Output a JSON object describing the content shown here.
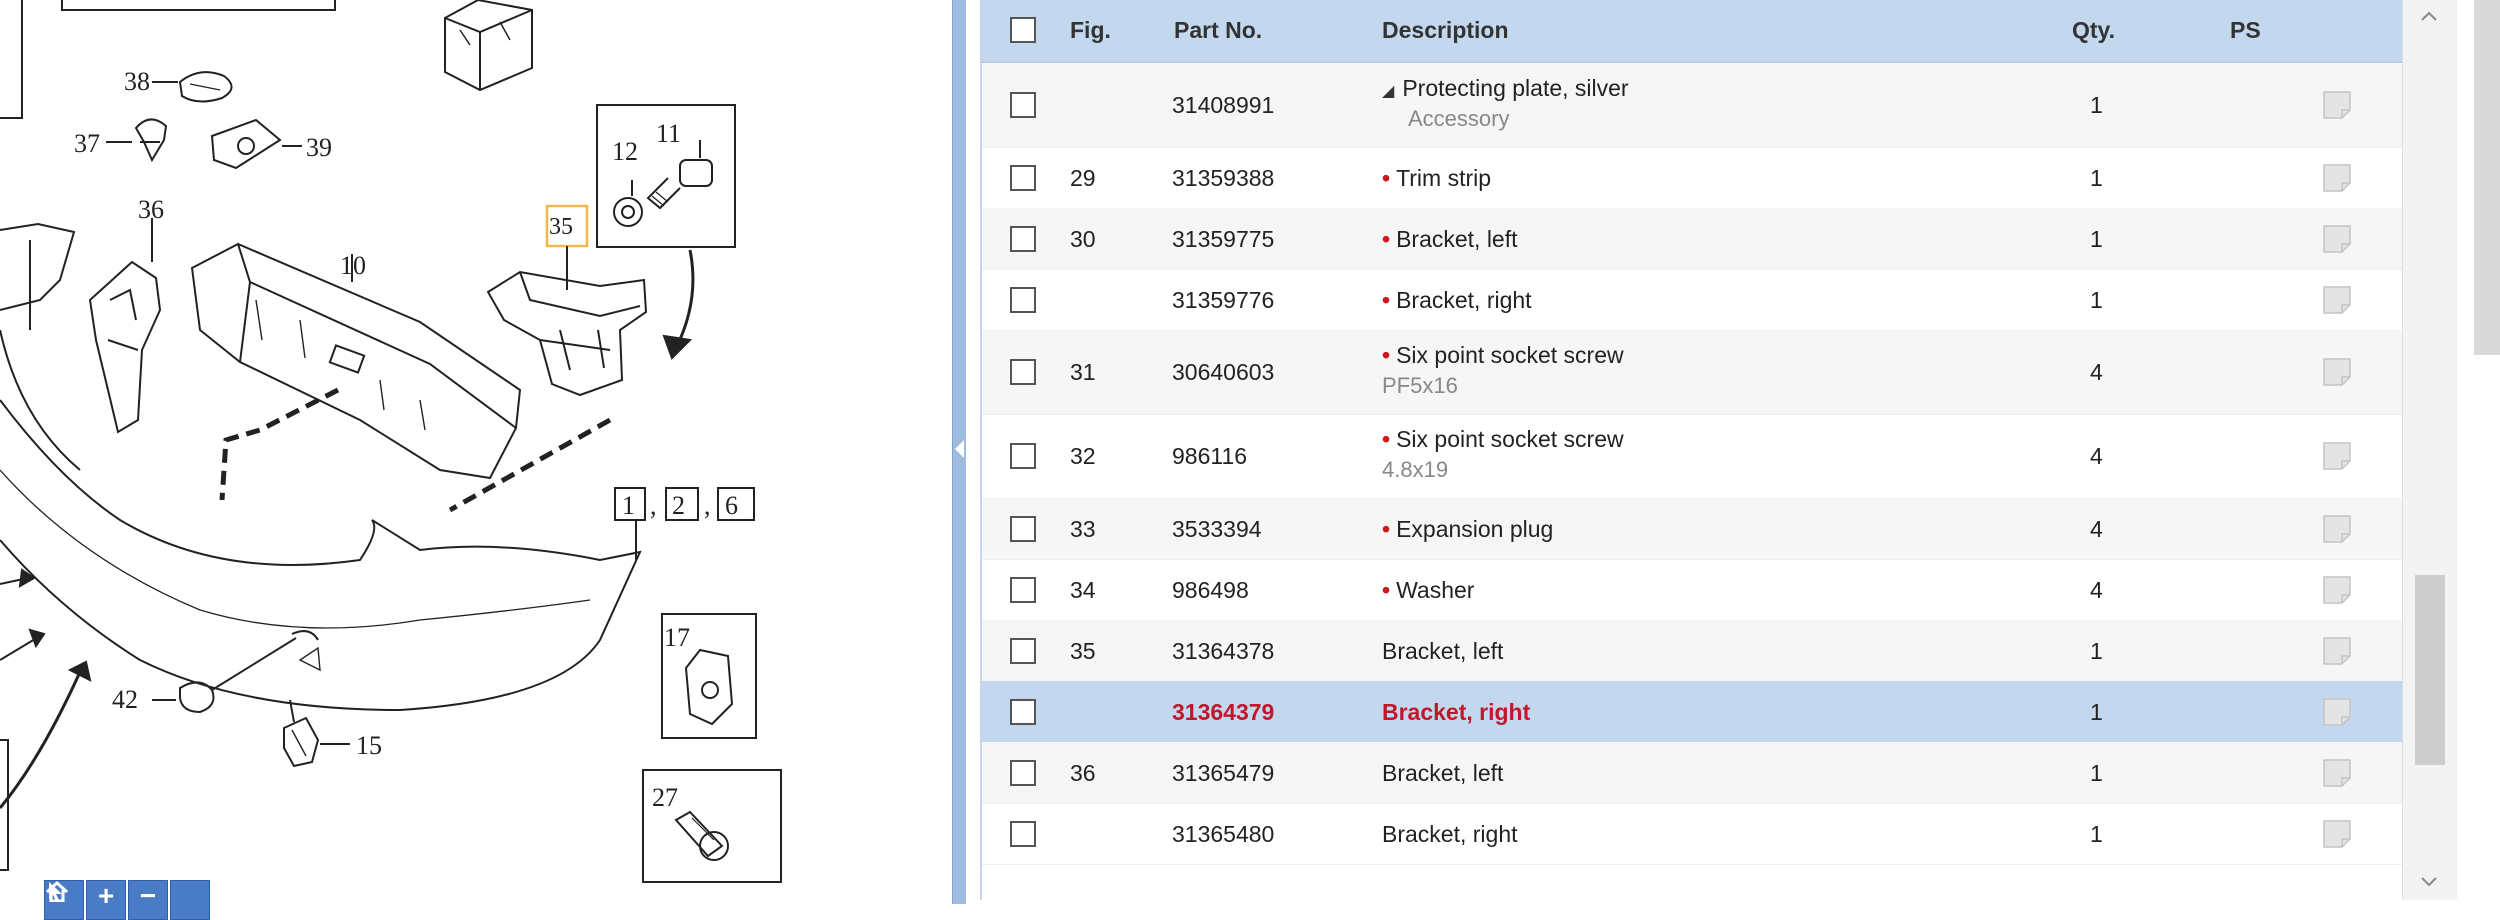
{
  "diagram": {
    "callouts": [
      {
        "id": "c38",
        "label": "38"
      },
      {
        "id": "c37",
        "label": "37"
      },
      {
        "id": "c39",
        "label": "39"
      },
      {
        "id": "c12",
        "label": "12"
      },
      {
        "id": "c11",
        "label": "11"
      },
      {
        "id": "c36",
        "label": "36"
      },
      {
        "id": "c10",
        "label": "10"
      },
      {
        "id": "c35",
        "label": "35"
      },
      {
        "id": "c1",
        "label": "1"
      },
      {
        "id": "c2",
        "label": "2"
      },
      {
        "id": "c6",
        "label": "6"
      },
      {
        "id": "c17",
        "label": "17"
      },
      {
        "id": "c42",
        "label": "42"
      },
      {
        "id": "c15",
        "label": "15"
      },
      {
        "id": "c27",
        "label": "27"
      }
    ],
    "highlight_color": "#f0b84a",
    "toolbar": [
      {
        "icon": "cursor-icon",
        "glyph": ""
      },
      {
        "icon": "zoom-in-icon",
        "glyph": "+"
      },
      {
        "icon": "zoom-out-icon",
        "glyph": "−"
      },
      {
        "icon": "home-icon",
        "glyph": ""
      }
    ]
  },
  "table": {
    "headers": {
      "fig": "Fig.",
      "part": "Part No.",
      "desc": "Description",
      "qty": "Qty.",
      "ps": "PS"
    },
    "accent_color": "#c0182b",
    "header_color": "#c3d8ee",
    "rows": [
      {
        "fig": "",
        "part": "31408991",
        "desc": "Protecting plate, silver",
        "prefix": "triangle",
        "sub": "Accessory",
        "qty": "1"
      },
      {
        "fig": "29",
        "part": "31359388",
        "desc": "Trim strip",
        "prefix": "dot",
        "sub": "",
        "qty": "1"
      },
      {
        "fig": "30",
        "part": "31359775",
        "desc": "Bracket, left",
        "prefix": "dot",
        "sub": "",
        "qty": "1"
      },
      {
        "fig": "",
        "part": "31359776",
        "desc": "Bracket, right",
        "prefix": "dot",
        "sub": "",
        "qty": "1"
      },
      {
        "fig": "31",
        "part": "30640603",
        "desc": "Six point socket screw",
        "prefix": "dot",
        "sub": "PF5x16",
        "qty": "4"
      },
      {
        "fig": "32",
        "part": "986116",
        "desc": "Six point socket screw",
        "prefix": "dot",
        "sub": "4.8x19",
        "qty": "4"
      },
      {
        "fig": "33",
        "part": "3533394",
        "desc": "Expansion plug",
        "prefix": "dot",
        "sub": "",
        "qty": "4"
      },
      {
        "fig": "34",
        "part": "986498",
        "desc": "Washer",
        "prefix": "dot",
        "sub": "",
        "qty": "4"
      },
      {
        "fig": "35",
        "part": "31364378",
        "desc": "Bracket, left",
        "prefix": "",
        "sub": "",
        "qty": "1"
      },
      {
        "fig": "",
        "part": "31364379",
        "desc": "Bracket, right",
        "prefix": "",
        "sub": "",
        "qty": "1",
        "selected": true
      },
      {
        "fig": "36",
        "part": "31365479",
        "desc": "Bracket, left",
        "prefix": "",
        "sub": "",
        "qty": "1"
      },
      {
        "fig": "",
        "part": "31365480",
        "desc": "Bracket, right",
        "prefix": "",
        "sub": "",
        "qty": "1"
      }
    ]
  }
}
